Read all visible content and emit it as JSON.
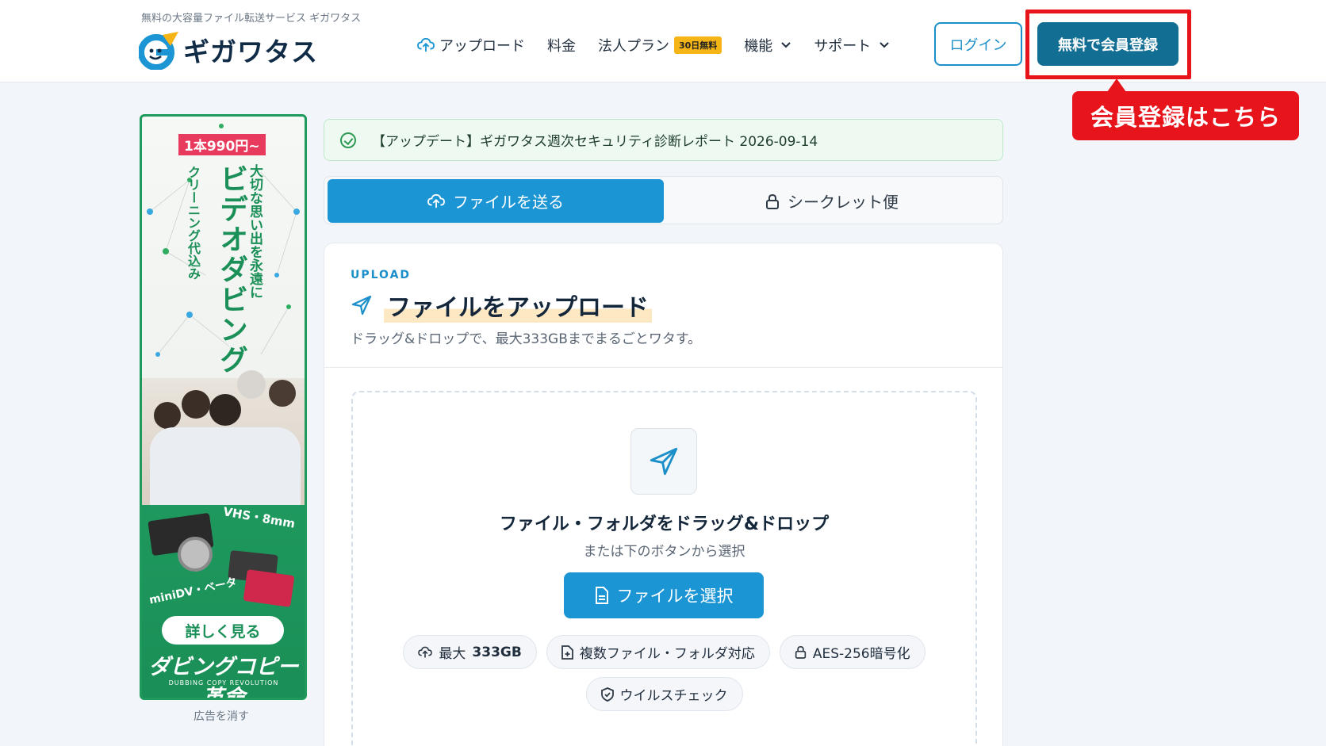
{
  "header": {
    "tagline": "無料の大容量ファイル転送サービス ギガワタス",
    "logo_text": "ギガワタス",
    "nav": [
      {
        "label": "アップロード"
      },
      {
        "label": "料金"
      },
      {
        "label": "法人プラン",
        "badge": "30日無料"
      },
      {
        "label": "機能"
      },
      {
        "label": "サポート"
      }
    ],
    "login_label": "ログイン",
    "register_label": "無料で会員登録",
    "callout": "会員登録はこちら",
    "colors": {
      "accent": "#1b95d3",
      "register": "#136e93",
      "callout": "#e8141c"
    }
  },
  "ad": {
    "price": "1本990円~",
    "line1": "大切な思い出を永遠に",
    "line2": "ビデオダビング",
    "line3": "クリーニング代込み",
    "formats_top": "VHS・8mm",
    "formats_bottom": "miniDV・ベータ",
    "cta": "詳しく見る",
    "brand": "ダビングコピー革命",
    "brand_sub": "DUBBING COPY REVOLUTION",
    "remove_label": "広告を消す"
  },
  "notice": {
    "text": "【アップデート】ギガワタス週次セキュリティ診断レポート 2026-09-14"
  },
  "tabs": {
    "send": "ファイルを送る",
    "secret": "シークレット便"
  },
  "upload": {
    "eyebrow": "UPLOAD",
    "title": "ファイルをアップロード",
    "subtitle": "ドラッグ&ドロップで、最大333GBまでまるごとワタす。",
    "dz_title": "ファイル・フォルダをドラッグ&ドロップ",
    "dz_sub": "または下のボタンから選択",
    "select_button": "ファイルを選択",
    "chips": {
      "max_prefix": "最大",
      "max_value": "333GB",
      "multi": "複数ファイル・フォルダ対応",
      "aes": "AES-256暗号化",
      "virus": "ウイルスチェック"
    }
  }
}
